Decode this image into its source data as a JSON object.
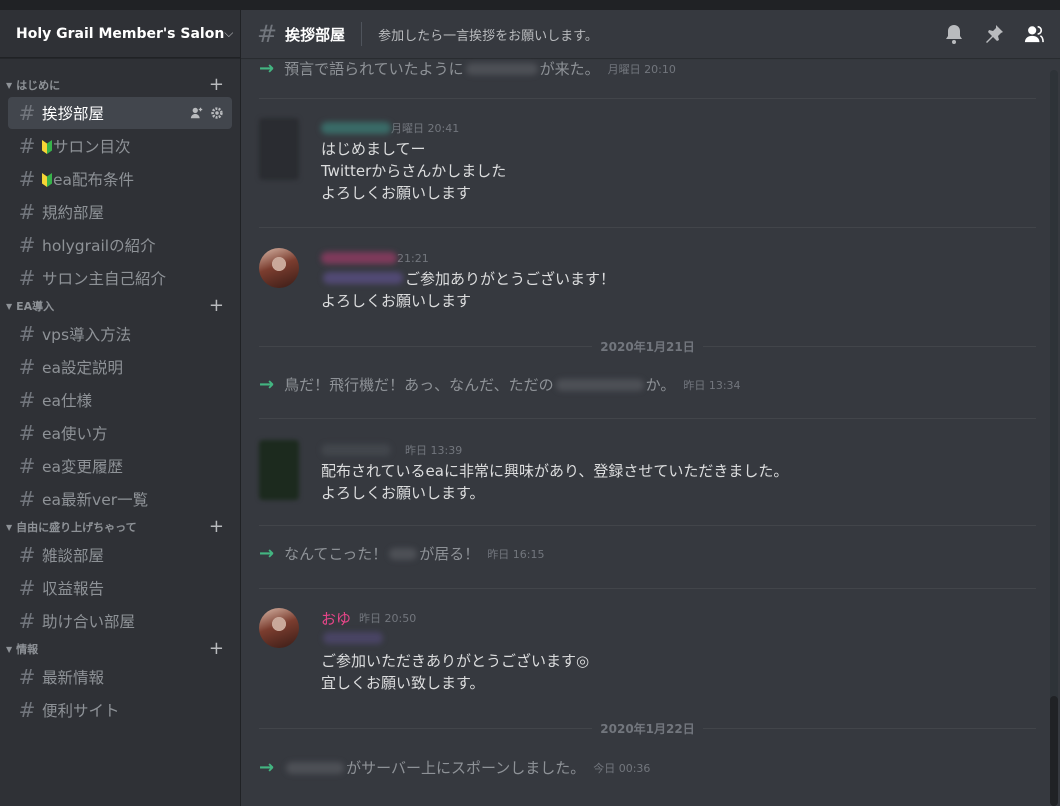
{
  "guild": {
    "name": "Holy Grail Member's Salon"
  },
  "categories": [
    {
      "label": "はじめに",
      "channels": [
        {
          "label": "挨拶部屋",
          "active": true
        },
        {
          "label": "サロン目次",
          "beginner": true
        },
        {
          "label": "ea配布条件",
          "beginner": true
        },
        {
          "label": "規約部屋"
        },
        {
          "label": "holygrailの紹介"
        },
        {
          "label": "サロン主自己紹介"
        }
      ]
    },
    {
      "label": "EA導入",
      "channels": [
        {
          "label": "vps導入方法"
        },
        {
          "label": "ea設定説明"
        },
        {
          "label": "ea仕様"
        },
        {
          "label": "ea使い方"
        },
        {
          "label": "ea変更履歴"
        },
        {
          "label": "ea最新ver一覧"
        }
      ]
    },
    {
      "label": "自由に盛り上げちゃって",
      "channels": [
        {
          "label": "雑談部屋"
        },
        {
          "label": "収益報告"
        },
        {
          "label": "助け合い部屋"
        }
      ]
    },
    {
      "label": "情報",
      "channels": [
        {
          "label": "最新情報"
        },
        {
          "label": "便利サイト"
        }
      ]
    }
  ],
  "header": {
    "channel": "挨拶部屋",
    "topic": "参加したら一言挨拶をお願いします。"
  },
  "messages": {
    "sys1": {
      "pre": "預言で語られていたように",
      "post": "が来た。",
      "time": "月曜日 20:10"
    },
    "msg1": {
      "time": "月曜日 20:41",
      "lines": [
        "はじめましてー",
        "Twitterからさんかしました",
        "よろしくお願いします"
      ]
    },
    "msg2": {
      "time": "21:21",
      "lines": [
        "ご参加ありがとうございます！",
        "よろしくお願いします"
      ]
    },
    "date1": "2020年1月21日",
    "sys2": {
      "pre": "鳥だ！飛行機だ！あっ、なんだ、ただの",
      "post": "か。",
      "time": "昨日 13:34"
    },
    "msg3": {
      "time": "昨日 13:39",
      "lines": [
        "配布されているeaに非常に興味があり、登録させていただきました。",
        "よろしくお願いします。"
      ]
    },
    "sys3": {
      "pre": "なんてこった！",
      "post": "が居る！",
      "time": "昨日 16:15"
    },
    "msg4": {
      "author": "おゆ",
      "time": "昨日 20:50",
      "lines": [
        "ご参加いただきありがとうございます◎",
        "宜しくお願い致します。"
      ]
    },
    "date2": "2020年1月22日",
    "sys4": {
      "post": "がサーバー上にスポーンしました。",
      "time": "今日 00:36"
    }
  },
  "colors": {
    "accent_green": "#43b581",
    "author_pink": "#e64589",
    "sidebar": "#2f3136",
    "chat_bg": "#36393f"
  }
}
